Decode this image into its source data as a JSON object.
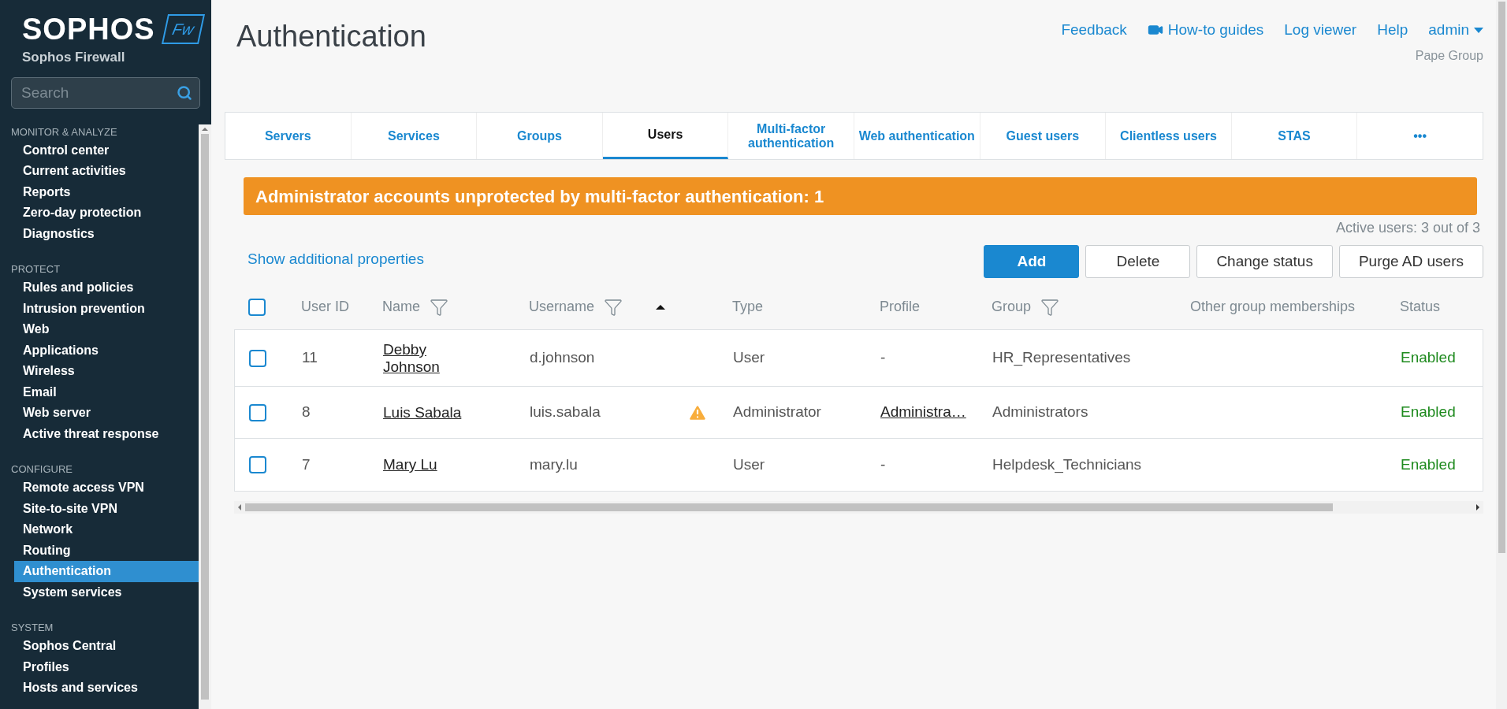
{
  "brand": {
    "logo": "SOPHOS",
    "badge": "Fw",
    "product": "Sophos Firewall"
  },
  "search": {
    "placeholder": "Search"
  },
  "sidebar": [
    {
      "heading": "MONITOR & ANALYZE",
      "items": [
        {
          "label": "Control center",
          "selected": false
        },
        {
          "label": "Current activities",
          "selected": false
        },
        {
          "label": "Reports",
          "selected": false
        },
        {
          "label": "Zero-day protection",
          "selected": false
        },
        {
          "label": "Diagnostics",
          "selected": false
        }
      ]
    },
    {
      "heading": "PROTECT",
      "items": [
        {
          "label": "Rules and policies",
          "selected": false
        },
        {
          "label": "Intrusion prevention",
          "selected": false
        },
        {
          "label": "Web",
          "selected": false
        },
        {
          "label": "Applications",
          "selected": false
        },
        {
          "label": "Wireless",
          "selected": false
        },
        {
          "label": "Email",
          "selected": false
        },
        {
          "label": "Web server",
          "selected": false
        },
        {
          "label": "Active threat response",
          "selected": false
        }
      ]
    },
    {
      "heading": "CONFIGURE",
      "items": [
        {
          "label": "Remote access VPN",
          "selected": false
        },
        {
          "label": "Site-to-site VPN",
          "selected": false
        },
        {
          "label": "Network",
          "selected": false
        },
        {
          "label": "Routing",
          "selected": false
        },
        {
          "label": "Authentication",
          "selected": true
        },
        {
          "label": "System services",
          "selected": false
        }
      ]
    },
    {
      "heading": "SYSTEM",
      "items": [
        {
          "label": "Sophos Central",
          "selected": false
        },
        {
          "label": "Profiles",
          "selected": false
        },
        {
          "label": "Hosts and services",
          "selected": false
        }
      ]
    }
  ],
  "page": {
    "title": "Authentication"
  },
  "header_links": [
    {
      "label": "Feedback",
      "kind": "link"
    },
    {
      "label": "How-to guides",
      "kind": "video"
    },
    {
      "label": "Log viewer",
      "kind": "link"
    },
    {
      "label": "Help",
      "kind": "link"
    },
    {
      "label": "admin",
      "kind": "menu"
    }
  ],
  "organization": "Pape Group",
  "tabs": [
    {
      "label": "Servers",
      "selected": false
    },
    {
      "label": "Services",
      "selected": false
    },
    {
      "label": "Groups",
      "selected": false
    },
    {
      "label": "Users",
      "selected": true
    },
    {
      "label": "Multi-factor authentication",
      "selected": false
    },
    {
      "label": "Web authentication",
      "selected": false
    },
    {
      "label": "Guest users",
      "selected": false
    },
    {
      "label": "Clientless users",
      "selected": false
    },
    {
      "label": "STAS",
      "selected": false
    },
    {
      "label": "•••",
      "selected": false
    }
  ],
  "alert": "Administrator accounts unprotected by multi-factor authentication: 1",
  "active_users": "Active users: 3 out of 3",
  "show_more": "Show additional properties",
  "actions": [
    {
      "label": "Add",
      "primary": true
    },
    {
      "label": "Delete",
      "primary": false
    },
    {
      "label": "Change status",
      "primary": false
    },
    {
      "label": "Purge AD users",
      "primary": false
    }
  ],
  "table": {
    "select_all": false,
    "columns": [
      {
        "label": "User ID",
        "filter": false
      },
      {
        "label": "Name",
        "filter": true
      },
      {
        "label": "Username",
        "filter": true,
        "sorted": true
      },
      {
        "label": "Type",
        "filter": false
      },
      {
        "label": "Profile",
        "filter": false
      },
      {
        "label": "Group",
        "filter": true
      },
      {
        "label": "Other group memberships",
        "filter": false
      },
      {
        "label": "Status",
        "filter": false
      }
    ],
    "rows": [
      {
        "checked": false,
        "user_id": "11",
        "name": "Debby Johnson",
        "username": "d.johnson",
        "warning": false,
        "type": "User",
        "profile": "-",
        "profile_link": false,
        "group": "HR_Representatives",
        "other_groups": "",
        "status": "Enabled"
      },
      {
        "checked": false,
        "user_id": "8",
        "name": "Luis Sabala",
        "username": "luis.sabala",
        "warning": true,
        "type": "Administrator",
        "profile": "Administra…",
        "profile_link": true,
        "group": "Administrators",
        "other_groups": "",
        "status": "Enabled"
      },
      {
        "checked": false,
        "user_id": "7",
        "name": "Mary Lu",
        "username": "mary.lu",
        "warning": false,
        "type": "User",
        "profile": "-",
        "profile_link": false,
        "group": "Helpdesk_Technicians",
        "other_groups": "",
        "status": "Enabled"
      }
    ]
  }
}
